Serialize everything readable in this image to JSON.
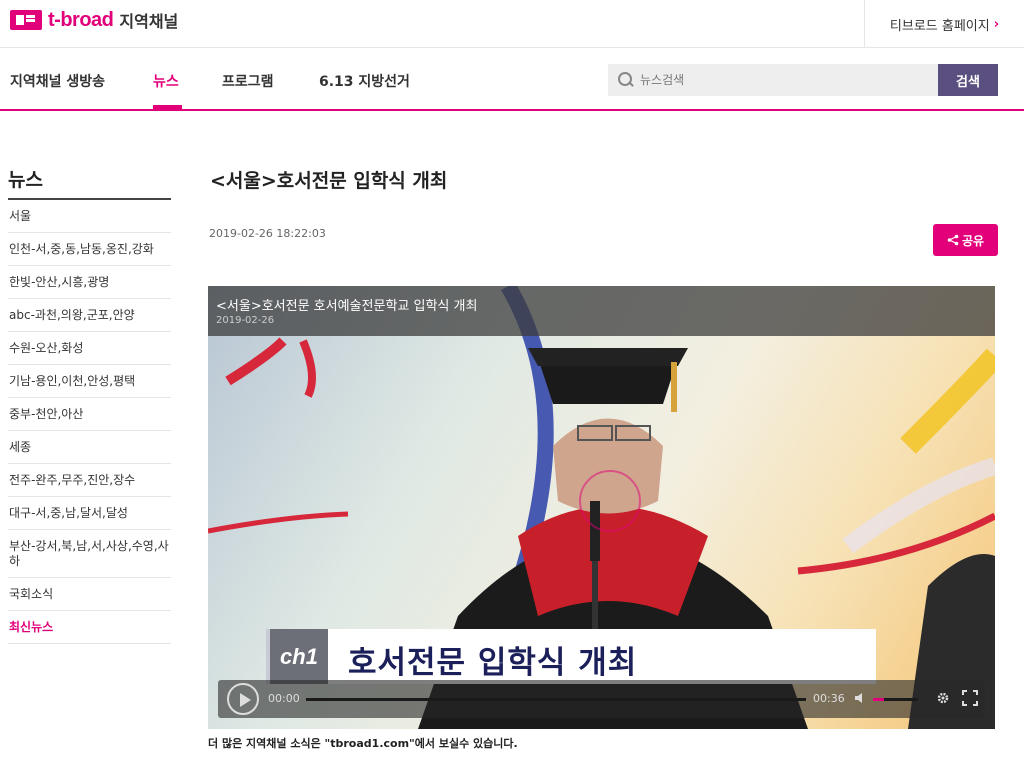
{
  "header": {
    "logo_text": "t-broad",
    "logo_sub": "지역채널",
    "home_link": "티브로드 홈페이지"
  },
  "nav": {
    "items": [
      "지역채널 생방송",
      "뉴스",
      "프로그램",
      "6.13 지방선거"
    ],
    "active_index": 1,
    "search_placeholder": "뉴스검색",
    "search_button": "검색"
  },
  "sidebar": {
    "title": "뉴스",
    "items": [
      "서울",
      "인천-서,중,동,남동,옹진,강화",
      "한빛-안산,시흥,광명",
      "abc-과천,의왕,군포,안양",
      "수원-오산,화성",
      "기남-용인,이천,안성,평택",
      "중부-천안,아산",
      "세종",
      "전주-완주,무주,진안,장수",
      "대구-서,중,남,달서,달성",
      "부산-강서,북,남,서,사상,수영,사하",
      "국회소식",
      "최신뉴스"
    ],
    "active_label": "최신뉴스"
  },
  "article": {
    "title": "<서울>호서전문 입학식 개최",
    "date": "2019-02-26 18:22:03",
    "share_label": "공유",
    "footnote": "더 많은 지역채널 소식은 \"tbroad1.com\"에서 보실수 있습니다."
  },
  "video": {
    "overlay_title": "<서울>호서전문 호서예술전문학교 입학식 개최",
    "overlay_date": "2019-02-26",
    "caption_logo": "ch1",
    "caption_text": "호서전문 입학식 개최",
    "time_current": "00:00",
    "time_duration": "00:36",
    "volume_level": 0.25
  },
  "colors": {
    "accent": "#e2007a",
    "search_button": "#5b4f7f"
  }
}
